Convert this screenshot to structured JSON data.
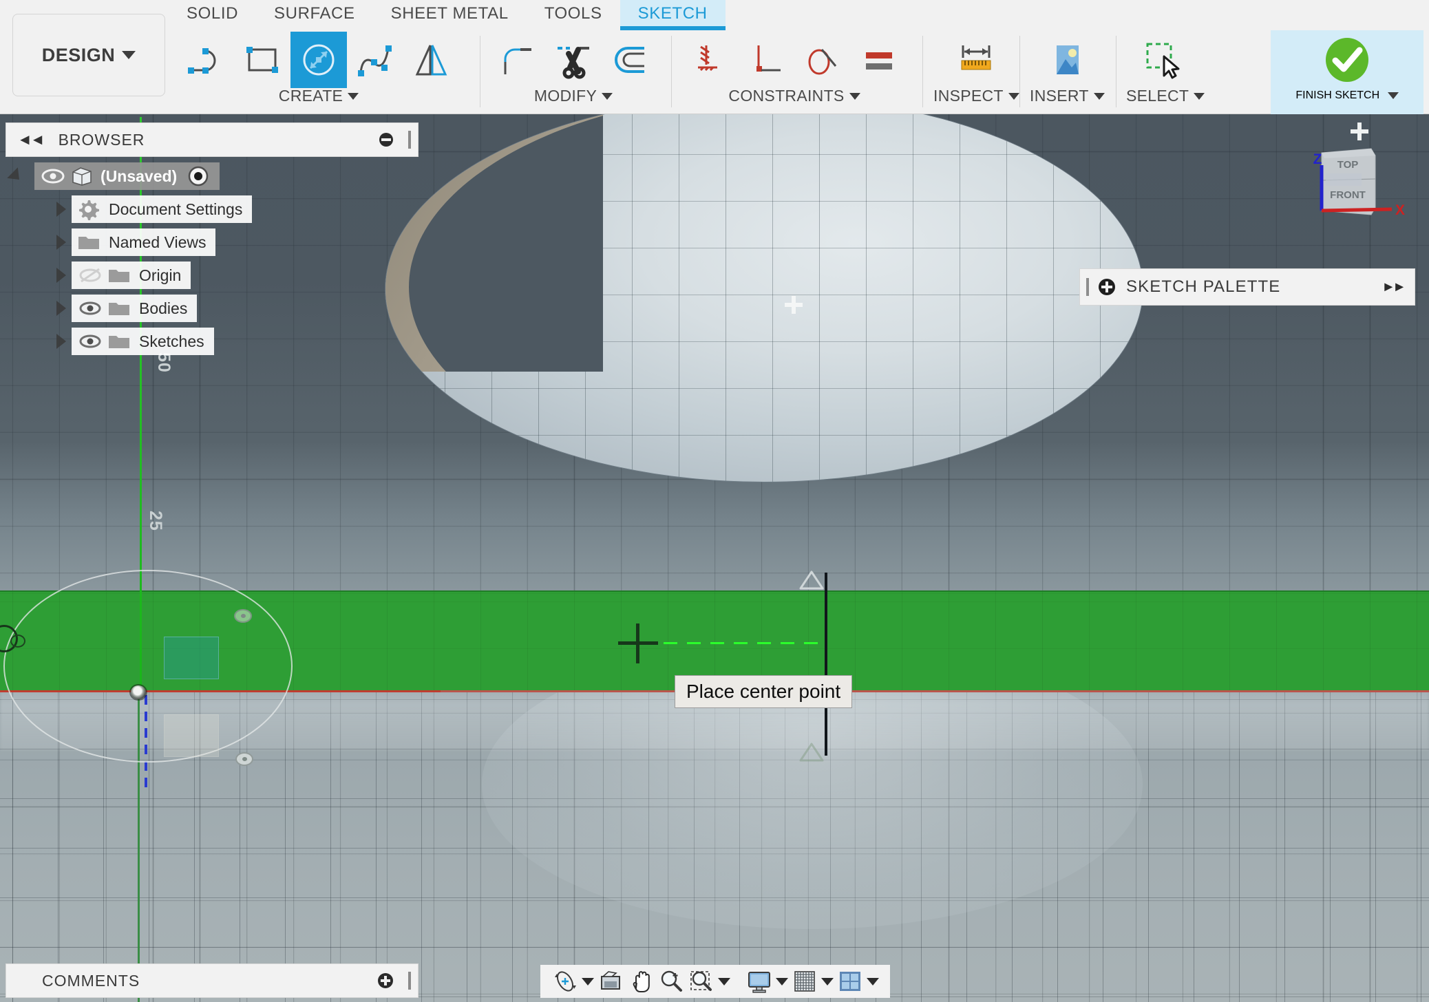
{
  "app": {
    "workspace_button": "DESIGN",
    "tabs": [
      {
        "label": "SOLID",
        "active": false
      },
      {
        "label": "SURFACE",
        "active": false
      },
      {
        "label": "SHEET METAL",
        "active": false
      },
      {
        "label": "TOOLS",
        "active": false
      },
      {
        "label": "SKETCH",
        "active": true
      }
    ],
    "accent_blue": "#1c9ad6",
    "tab_active_bg": "#d3ecf8",
    "selection_green": "#2e9e35",
    "finish_green": "#5cb82a"
  },
  "ribbon": {
    "groups": [
      {
        "label": "CREATE",
        "has_caret": true,
        "tools": [
          {
            "name": "line-icon",
            "selected": false
          },
          {
            "name": "rectangle-icon",
            "selected": false
          },
          {
            "name": "circle-icon",
            "selected": true
          },
          {
            "name": "spline-icon",
            "selected": false
          },
          {
            "name": "mirror-icon",
            "selected": false
          }
        ]
      },
      {
        "label": "MODIFY",
        "has_caret": true,
        "tools": [
          {
            "name": "fillet-icon",
            "selected": false
          },
          {
            "name": "trim-scissors-icon",
            "selected": false
          },
          {
            "name": "offset-icon",
            "selected": false
          }
        ]
      },
      {
        "label": "CONSTRAINTS",
        "has_caret": true,
        "tools": [
          {
            "name": "fix-ground-icon",
            "selected": false
          },
          {
            "name": "perpendicular-icon",
            "selected": false
          },
          {
            "name": "tangent-icon",
            "selected": false
          },
          {
            "name": "equal-icon",
            "selected": false
          }
        ]
      },
      {
        "label": "INSPECT",
        "has_caret": true,
        "tools": [
          {
            "name": "measure-ruler-icon",
            "selected": false
          }
        ]
      },
      {
        "label": "INSERT",
        "has_caret": true,
        "tools": [
          {
            "name": "insert-image-icon",
            "selected": false
          }
        ]
      },
      {
        "label": "SELECT",
        "has_caret": true,
        "tools": [
          {
            "name": "select-window-cursor-icon",
            "selected": false
          }
        ]
      }
    ],
    "finish": {
      "label": "FINISH SKETCH",
      "icon": "green-check-icon",
      "has_caret": true,
      "highlighted": true
    }
  },
  "browser": {
    "title": "BROWSER",
    "collapse_icon": "double-chevron-left-icon",
    "minimize_icon": "minus-circle-icon",
    "grip_icon": "resize-grip-icon",
    "tree": [
      {
        "label": "(Unsaved)",
        "icon": "document-cube-icon",
        "eye": "eye-visible-icon",
        "radio": "active-radio-icon",
        "expanded": true,
        "root": true,
        "indent": 0
      },
      {
        "label": "Document Settings",
        "icon": "gear-icon",
        "eye": null,
        "expanded": false,
        "root": false,
        "indent": 1
      },
      {
        "label": "Named Views",
        "icon": "folder-icon",
        "eye": null,
        "expanded": false,
        "root": false,
        "indent": 1
      },
      {
        "label": "Origin",
        "icon": "folder-icon",
        "eye": "eye-hidden-icon",
        "expanded": false,
        "root": false,
        "indent": 1
      },
      {
        "label": "Bodies",
        "icon": "folder-icon",
        "eye": "eye-visible-icon",
        "expanded": false,
        "root": false,
        "indent": 1
      },
      {
        "label": "Sketches",
        "icon": "folder-icon",
        "eye": "eye-visible-icon",
        "expanded": false,
        "root": false,
        "indent": 1
      }
    ]
  },
  "sketch_palette": {
    "title": "SKETCH PALETTE",
    "expand_icon": "plus-circle-icon",
    "forward_icon": "double-chevron-right-icon",
    "grip_icon": "resize-grip-icon"
  },
  "viewcube": {
    "top_face": "TOP",
    "front_face": "FRONT",
    "axis_x": "X",
    "axis_z": "Z",
    "home_icon": "plus-home-icon",
    "x_color": "#cc2222",
    "z_color": "#2222cc"
  },
  "canvas": {
    "tooltip": "Place center point",
    "ruler_labels": [
      "50",
      "25"
    ],
    "cursor_icon": "crosshair-cursor",
    "center_point_icon": "face-center-point-icon",
    "inference_icon": "horizontal-inference-line",
    "constraint_glyph": "triangle-constraint-icon"
  },
  "comments": {
    "title": "COMMENTS",
    "add_icon": "plus-circle-icon",
    "grip_icon": "resize-grip-icon"
  },
  "navbar": {
    "buttons": [
      {
        "name": "orbit-icon",
        "caret": true
      },
      {
        "name": "look-at-icon",
        "caret": false
      },
      {
        "name": "pan-hand-icon",
        "caret": false
      },
      {
        "name": "zoom-magnifier-icon",
        "caret": false
      },
      {
        "name": "zoom-window-icon",
        "caret": true
      },
      {
        "name": "display-settings-icon",
        "caret": true
      },
      {
        "name": "grid-snaps-icon",
        "caret": true
      },
      {
        "name": "viewports-icon",
        "caret": true
      }
    ]
  }
}
